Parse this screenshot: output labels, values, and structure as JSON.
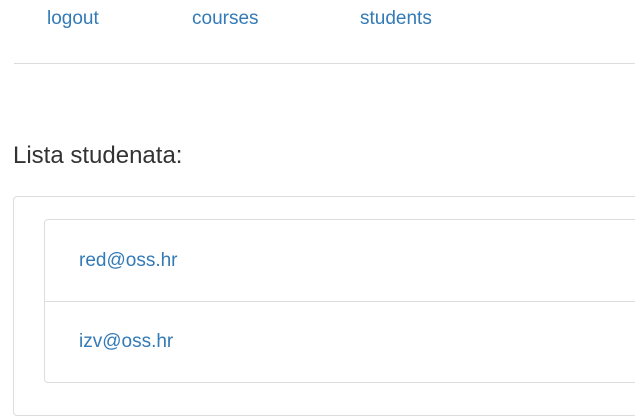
{
  "nav": {
    "items": [
      {
        "label": "logout"
      },
      {
        "label": "courses"
      },
      {
        "label": "students"
      }
    ]
  },
  "main": {
    "title": "Lista studenata:",
    "students": [
      {
        "email": "red@oss.hr"
      },
      {
        "email": "izv@oss.hr"
      }
    ]
  },
  "colors": {
    "link": "#337ab7",
    "text": "#333333",
    "border": "#dddddd"
  }
}
